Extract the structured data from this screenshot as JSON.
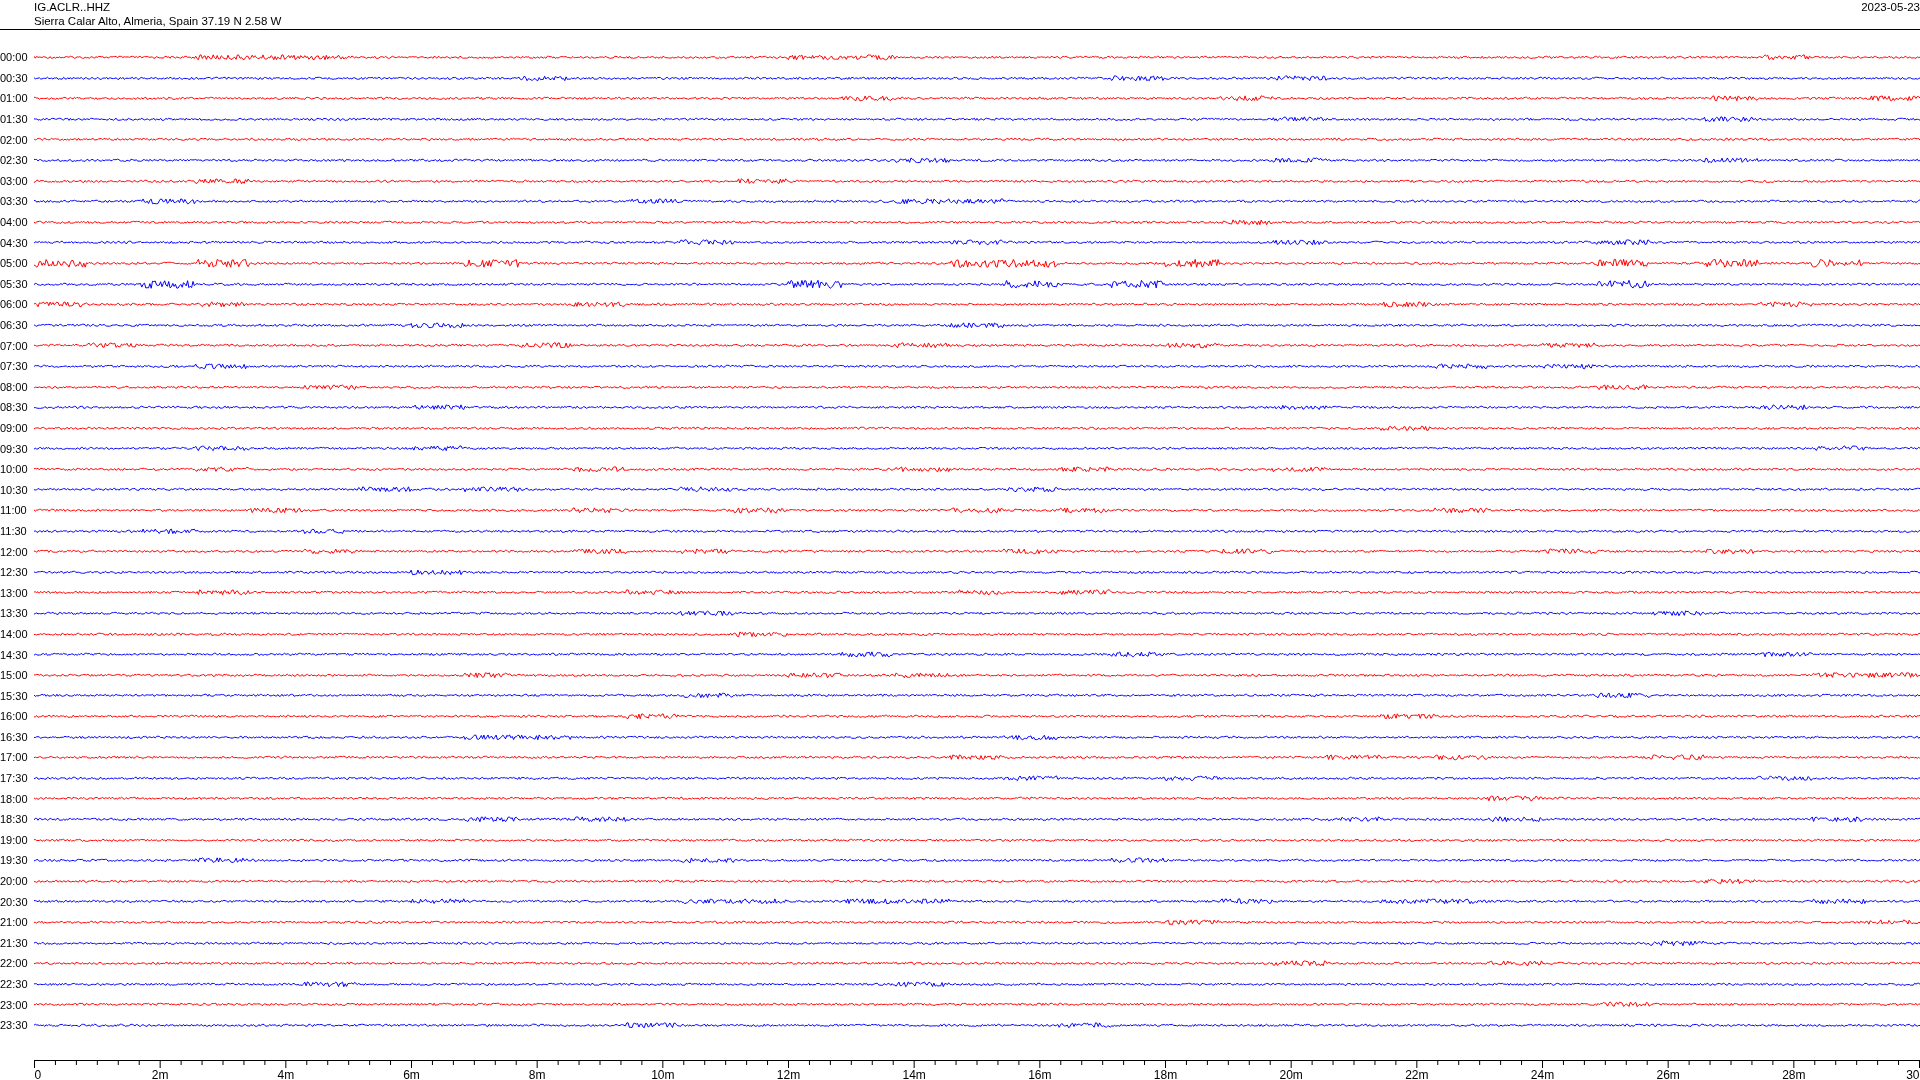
{
  "header": {
    "station": "IG.ACLR..HHZ",
    "location": "Sierra Calar Alto, Almeria, Spain  37.19 N 2.58 W",
    "date": "2023-05-23"
  },
  "rows": [
    {
      "label": "00:00",
      "color": "#ff0000"
    },
    {
      "label": "00:30",
      "color": "#0000ff"
    },
    {
      "label": "01:00",
      "color": "#ff0000"
    },
    {
      "label": "01:30",
      "color": "#0000ff"
    },
    {
      "label": "02:00",
      "color": "#ff0000"
    },
    {
      "label": "02:30",
      "color": "#0000ff"
    },
    {
      "label": "03:00",
      "color": "#ff0000"
    },
    {
      "label": "03:30",
      "color": "#0000ff"
    },
    {
      "label": "04:00",
      "color": "#ff0000"
    },
    {
      "label": "04:30",
      "color": "#0000ff"
    },
    {
      "label": "05:00",
      "color": "#ff0000"
    },
    {
      "label": "05:30",
      "color": "#0000ff"
    },
    {
      "label": "06:00",
      "color": "#ff0000"
    },
    {
      "label": "06:30",
      "color": "#0000ff"
    },
    {
      "label": "07:00",
      "color": "#ff0000"
    },
    {
      "label": "07:30",
      "color": "#0000ff"
    },
    {
      "label": "08:00",
      "color": "#ff0000"
    },
    {
      "label": "08:30",
      "color": "#0000ff"
    },
    {
      "label": "09:00",
      "color": "#ff0000"
    },
    {
      "label": "09:30",
      "color": "#0000ff"
    },
    {
      "label": "10:00",
      "color": "#ff0000"
    },
    {
      "label": "10:30",
      "color": "#0000ff"
    },
    {
      "label": "11:00",
      "color": "#ff0000"
    },
    {
      "label": "11:30",
      "color": "#0000ff"
    },
    {
      "label": "12:00",
      "color": "#ff0000"
    },
    {
      "label": "12:30",
      "color": "#0000ff"
    },
    {
      "label": "13:00",
      "color": "#ff0000"
    },
    {
      "label": "13:30",
      "color": "#0000ff"
    },
    {
      "label": "14:00",
      "color": "#ff0000"
    },
    {
      "label": "14:30",
      "color": "#0000ff"
    },
    {
      "label": "15:00",
      "color": "#ff0000"
    },
    {
      "label": "15:30",
      "color": "#0000ff"
    },
    {
      "label": "16:00",
      "color": "#ff0000"
    },
    {
      "label": "16:30",
      "color": "#0000ff"
    },
    {
      "label": "17:00",
      "color": "#ff0000"
    },
    {
      "label": "17:30",
      "color": "#0000ff"
    },
    {
      "label": "18:00",
      "color": "#ff0000"
    },
    {
      "label": "18:30",
      "color": "#0000ff"
    },
    {
      "label": "19:00",
      "color": "#ff0000"
    },
    {
      "label": "19:30",
      "color": "#0000ff"
    },
    {
      "label": "20:00",
      "color": "#ff0000"
    },
    {
      "label": "20:30",
      "color": "#0000ff"
    },
    {
      "label": "21:00",
      "color": "#ff0000"
    },
    {
      "label": "21:30",
      "color": "#0000ff"
    },
    {
      "label": "22:00",
      "color": "#ff0000"
    },
    {
      "label": "22:30",
      "color": "#0000ff"
    },
    {
      "label": "23:00",
      "color": "#ff0000"
    },
    {
      "label": "23:30",
      "color": "#0000ff"
    }
  ],
  "x_axis": {
    "ticks": [
      "0",
      "2m",
      "4m",
      "6m",
      "8m",
      "10m",
      "12m",
      "14m",
      "16m",
      "18m",
      "20m",
      "22m",
      "24m",
      "26m",
      "28m",
      "30"
    ]
  }
}
